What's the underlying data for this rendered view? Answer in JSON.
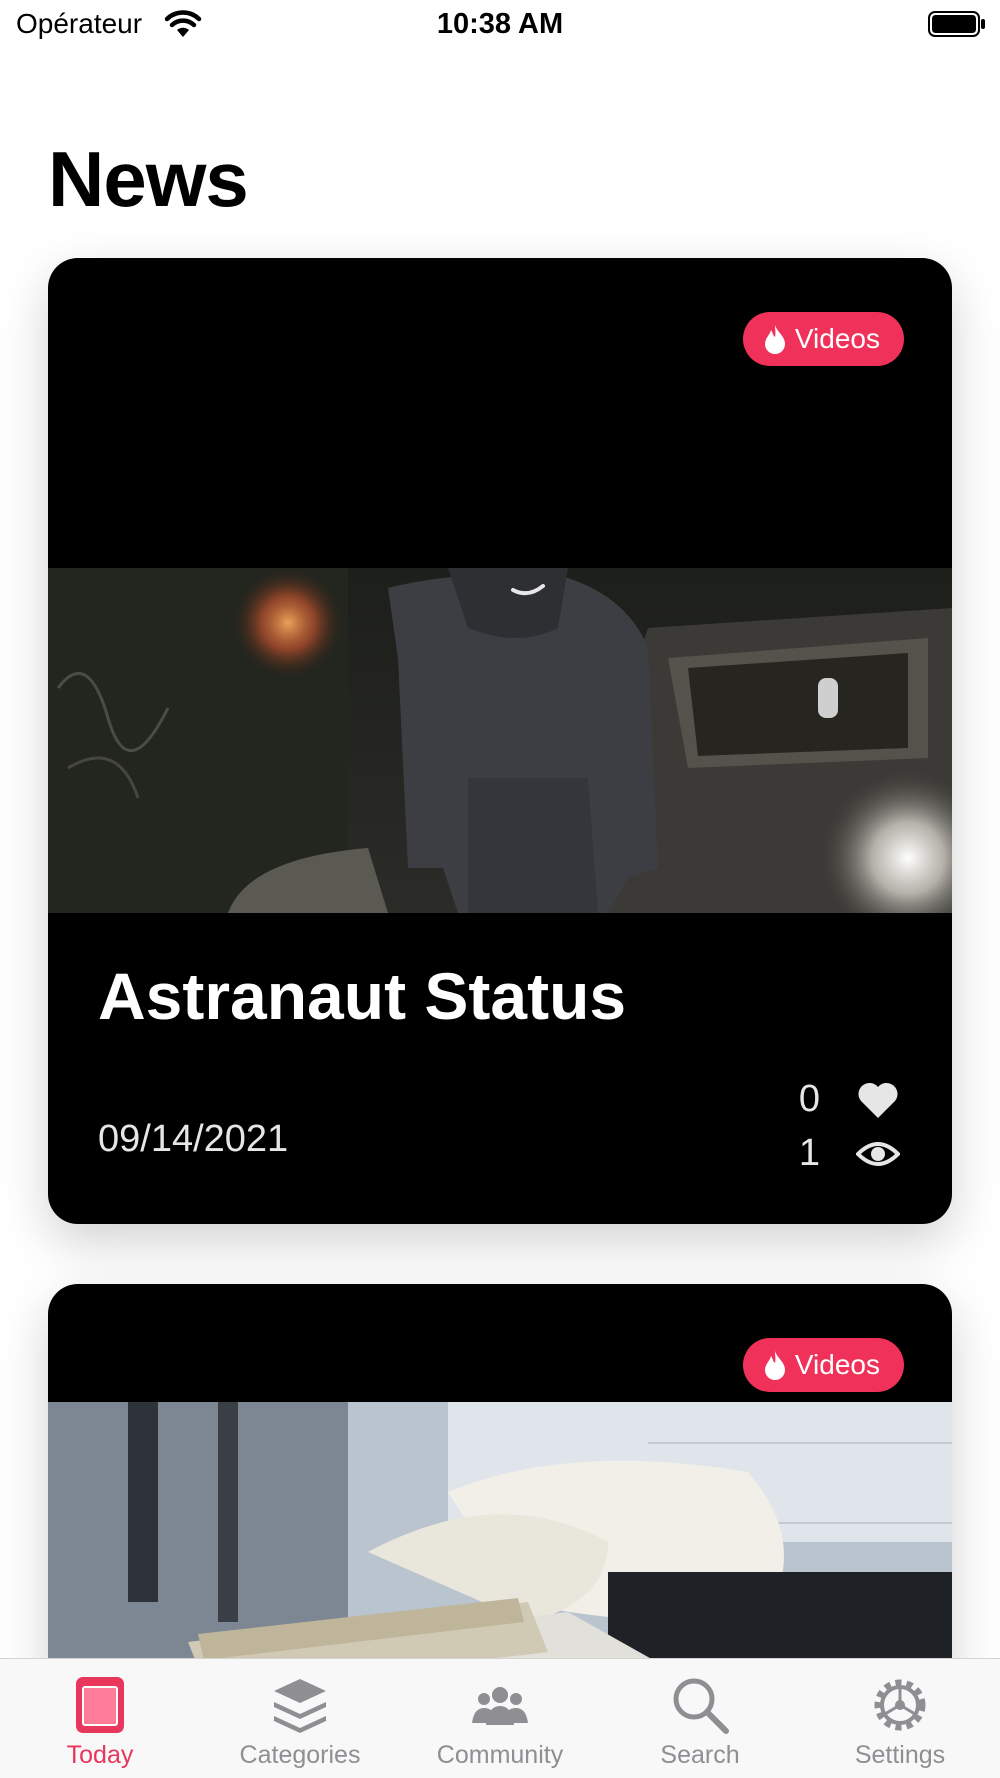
{
  "status_bar": {
    "carrier": "Opérateur",
    "time": "10:38 AM"
  },
  "page": {
    "title": "News"
  },
  "cards": [
    {
      "badge": "Videos",
      "title": "Astranaut Status",
      "date": "09/14/2021",
      "likes": "0",
      "views": "1",
      "thumbnail": "video-thumbnail-hoodie-car-night"
    },
    {
      "badge": "Videos",
      "thumbnail": "video-thumbnail-money-counter"
    }
  ],
  "tab_bar": {
    "items": [
      {
        "label": "Today",
        "icon": "today-icon",
        "active": true
      },
      {
        "label": "Categories",
        "icon": "layers-icon",
        "active": false
      },
      {
        "label": "Community",
        "icon": "people-icon",
        "active": false
      },
      {
        "label": "Search",
        "icon": "search-icon",
        "active": false
      },
      {
        "label": "Settings",
        "icon": "gear-icon",
        "active": false
      }
    ]
  },
  "colors": {
    "accent": "#f0325a",
    "tab_active": "#e8365d",
    "tab_inactive": "#8e8e93",
    "card_bg": "#000000"
  }
}
